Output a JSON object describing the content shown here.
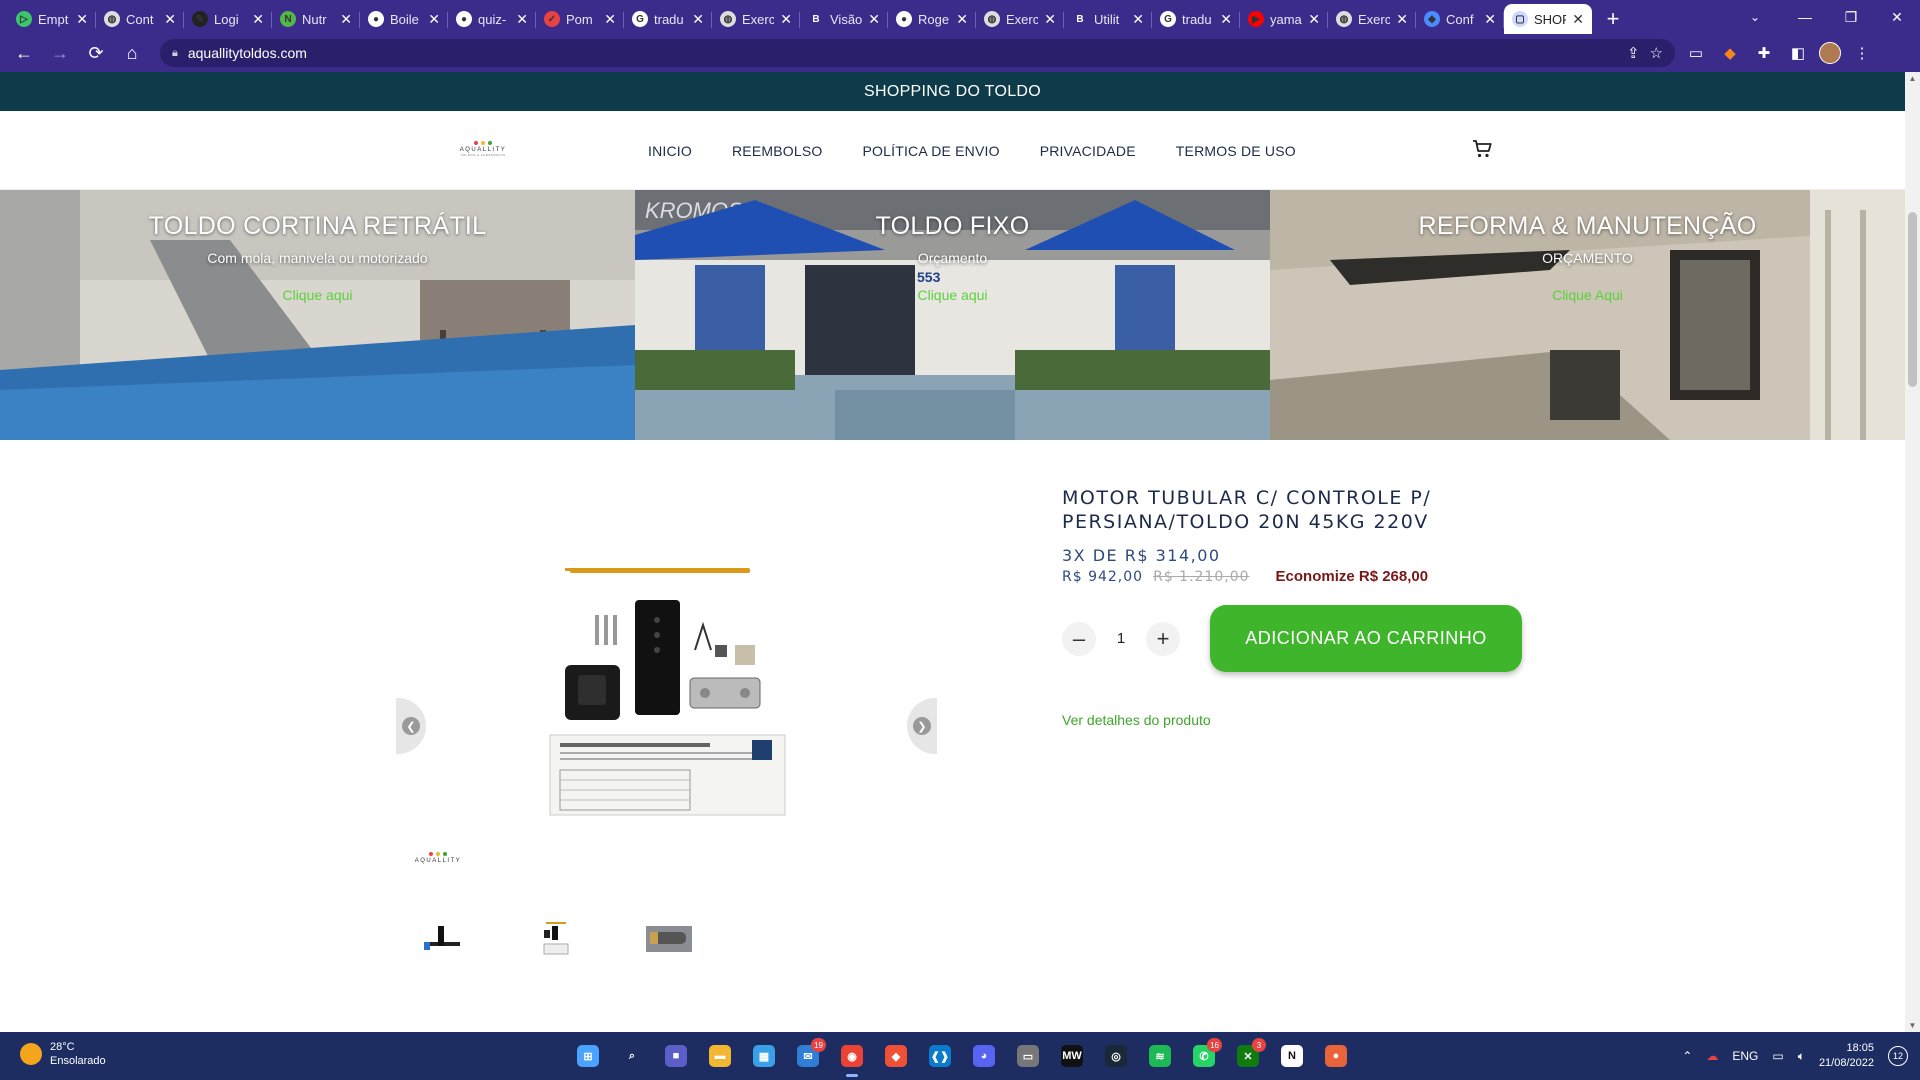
{
  "browser": {
    "tabs": [
      {
        "label": "Empt",
        "icon": "play-icon",
        "color": "#3ec46d"
      },
      {
        "label": "Cont",
        "icon": "globe-icon",
        "color": "#dddddd"
      },
      {
        "label": "Logi",
        "icon": "pen-icon",
        "color": "#222222"
      },
      {
        "label": "Nutr",
        "icon": "n-icon",
        "color": "#51b848"
      },
      {
        "label": "Boile",
        "icon": "github-icon",
        "color": "#ffffff"
      },
      {
        "label": "quiz-",
        "icon": "github-icon",
        "color": "#ffffff"
      },
      {
        "label": "Pom",
        "icon": "check-icon",
        "color": "#e84343"
      },
      {
        "label": "tradu",
        "icon": "google-icon",
        "color": "#ffffff"
      },
      {
        "label": "Exerc",
        "icon": "globe-icon",
        "color": "#dddddd"
      },
      {
        "label": "Visão",
        "icon": "b-icon",
        "color": "#3b2c8c"
      },
      {
        "label": "Roge",
        "icon": "github-icon",
        "color": "#ffffff"
      },
      {
        "label": "Exerc",
        "icon": "globe-icon",
        "color": "#dddddd"
      },
      {
        "label": "Utilit",
        "icon": "b-icon",
        "color": "#3b2c8c"
      },
      {
        "label": "tradu",
        "icon": "google-icon",
        "color": "#ffffff"
      },
      {
        "label": "yama",
        "icon": "youtube-icon",
        "color": "#ff0000"
      },
      {
        "label": "Exerc",
        "icon": "globe-icon",
        "color": "#dddddd"
      },
      {
        "label": "Conf",
        "icon": "cube-icon",
        "color": "#4a8cff"
      },
      {
        "label": "SHOP",
        "icon": "page-icon",
        "color": "#cfd8ff",
        "active": true
      }
    ],
    "url": "aquallitytoldos.com"
  },
  "site": {
    "announcement": "SHOPPING DO TOLDO",
    "logo_text": "AQUALLITY",
    "logo_sub": "TOLDOS & ACESSÓRIOS",
    "menu": [
      "INICIO",
      "REEMBOLSO",
      "POLÍTICA DE ENVIO",
      "PRIVACIDADE",
      "TERMOS DE USO"
    ],
    "banners": [
      {
        "title": "TOLDO CORTINA RETRÁTIL",
        "subtitle": "Com mola, manivela ou motorizado",
        "link": "Clique aqui"
      },
      {
        "title": "TOLDO FIXO",
        "subtitle": "Orçamento",
        "link": "Clique aqui"
      },
      {
        "title": "REFORMA & MANUTENÇÃO",
        "subtitle": "ORÇAMENTO",
        "link": "Clique Aqui"
      }
    ],
    "banner_storefront_text": "KROMOS",
    "banner_storefront_number": "553"
  },
  "product": {
    "title": "MOTOR TUBULAR C/ CONTROLE P/ PERSIANA/TOLDO 20N 45KG 220V",
    "installments": "3X DE R$ 314,00",
    "price": "R$ 942,00",
    "old_price": "R$ 1.210,00",
    "savings": "Economize R$ 268,00",
    "quantity": "1",
    "add_to_cart": "ADICIONAR AO CARRINHO",
    "details_link": "Ver detalhes do produto",
    "thumbnails": 3
  },
  "taskbar": {
    "weather_temp": "28°C",
    "weather_desc": "Ensolarado",
    "apps": [
      {
        "name": "windows-start-icon",
        "color": "#4aa3ff",
        "glyph": "⊞"
      },
      {
        "name": "search-icon",
        "color": "transparent",
        "glyph": "⌕"
      },
      {
        "name": "teams-icon",
        "color": "#5b5fc7",
        "glyph": "■"
      },
      {
        "name": "file-explorer-icon",
        "color": "#f2b731",
        "glyph": "▬"
      },
      {
        "name": "store-icon",
        "color": "#3aa0e8",
        "glyph": "▦"
      },
      {
        "name": "mail-icon",
        "color": "#2f7fd6",
        "glyph": "✉",
        "badge": "19"
      },
      {
        "name": "chrome-icon",
        "color": "#ea4335",
        "glyph": "◉",
        "active": true
      },
      {
        "name": "git-icon",
        "color": "#f05033",
        "glyph": "◆"
      },
      {
        "name": "vscode-icon",
        "color": "#0a7acc",
        "glyph": "❰❱"
      },
      {
        "name": "discord-icon",
        "color": "#5865f2",
        "glyph": "◕"
      },
      {
        "name": "monitor-icon",
        "color": "#777777",
        "glyph": "▭"
      },
      {
        "name": "mw-icon",
        "color": "#111111",
        "glyph": "MW"
      },
      {
        "name": "steam-icon",
        "color": "#1b2838",
        "glyph": "◎"
      },
      {
        "name": "spotify-icon",
        "color": "#1db954",
        "glyph": "≋"
      },
      {
        "name": "whatsapp-icon",
        "color": "#25d366",
        "glyph": "✆",
        "badge": "16"
      },
      {
        "name": "xbox-icon",
        "color": "#107c10",
        "glyph": "✕",
        "badge": "3"
      },
      {
        "name": "notion-icon",
        "color": "#ffffff",
        "glyph": "N"
      },
      {
        "name": "maps-icon",
        "color": "#e8643a",
        "glyph": "●"
      }
    ],
    "language": "ENG",
    "time": "18:05",
    "date": "21/08/2022",
    "notifications": "12"
  }
}
